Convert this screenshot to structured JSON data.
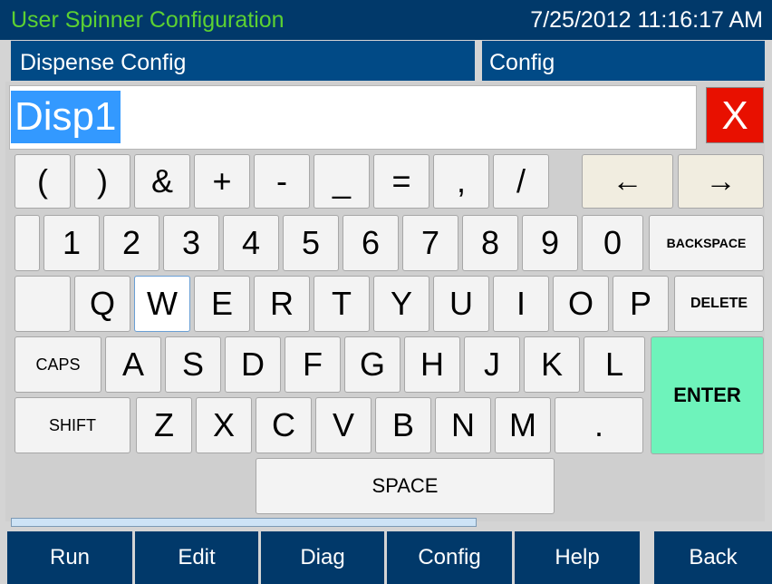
{
  "header": {
    "app_title": "User Spinner Configuration",
    "datetime": "7/25/2012 11:16:17 AM",
    "left_panel_title": "Dispense Config",
    "right_panel_title": "Config"
  },
  "input": {
    "value": "Disp1",
    "close_label": "X"
  },
  "keys": {
    "row1": [
      "(",
      ")",
      "&",
      "+",
      "-",
      "_",
      "=",
      ",",
      "/"
    ],
    "arrow_left": "←",
    "arrow_right": "→",
    "row2": [
      "1",
      "2",
      "3",
      "4",
      "5",
      "6",
      "7",
      "8",
      "9",
      "0"
    ],
    "backspace": "BACKSPACE",
    "row3": [
      "Q",
      "W",
      "E",
      "R",
      "T",
      "Y",
      "U",
      "I",
      "O",
      "P"
    ],
    "delete": "DELETE",
    "caps": "CAPS",
    "row4": [
      "A",
      "S",
      "D",
      "F",
      "G",
      "H",
      "J",
      "K",
      "L"
    ],
    "enter": "ENTER",
    "shift": "SHIFT",
    "row5": [
      "Z",
      "X",
      "C",
      "V",
      "B",
      "N",
      "M",
      "."
    ],
    "space": "SPACE"
  },
  "nav": {
    "run": "Run",
    "edit": "Edit",
    "diag": "Diag",
    "config": "Config",
    "help": "Help",
    "back": "Back"
  },
  "colors": {
    "title_text": "#5cd132",
    "header_bg": "#01396a",
    "enter_key": "#6ef3bb",
    "close_button": "#e81000",
    "selection": "#3399ff"
  }
}
